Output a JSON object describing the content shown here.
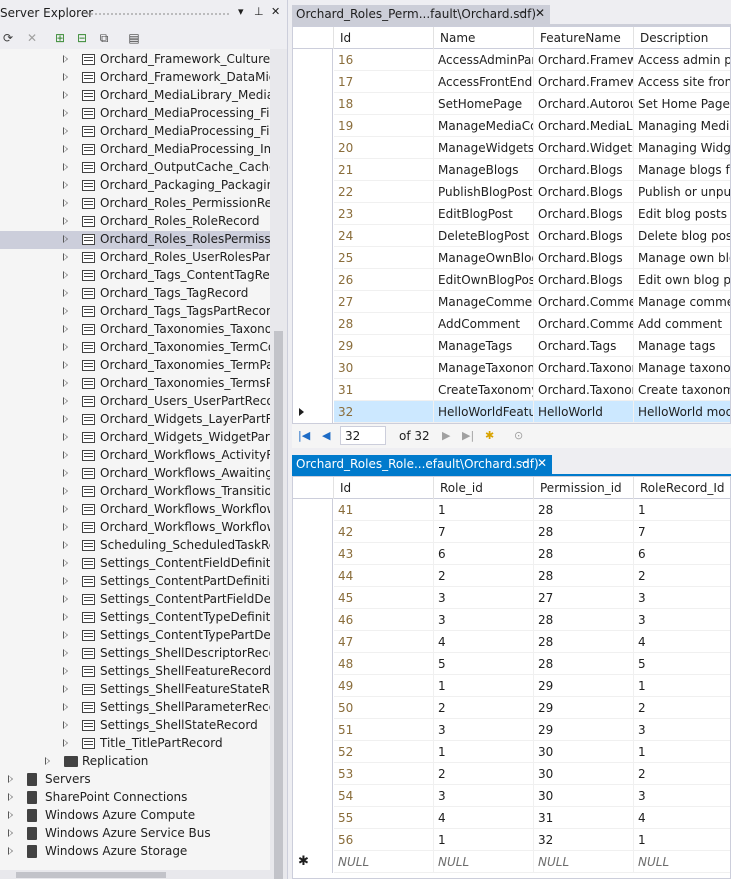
{
  "server_explorer": {
    "title": "Server Explorer",
    "tree": [
      {
        "label": "Orchard_Framework_CultureRecord",
        "type": "table",
        "level": 2
      },
      {
        "label": "Orchard_Framework_DataMigrationRecord",
        "type": "table",
        "level": 2
      },
      {
        "label": "Orchard_MediaLibrary_MediaPartRecord",
        "type": "table",
        "level": 2
      },
      {
        "label": "Orchard_MediaProcessing_FileNameRecord",
        "type": "table",
        "level": 2
      },
      {
        "label": "Orchard_MediaProcessing_FilterRecord",
        "type": "table",
        "level": 2
      },
      {
        "label": "Orchard_MediaProcessing_ImageProfilePartRecord",
        "type": "table",
        "level": 2
      },
      {
        "label": "Orchard_OutputCache_CacheParameterRecord",
        "type": "table",
        "level": 2
      },
      {
        "label": "Orchard_Packaging_PackagingSource",
        "type": "table",
        "level": 2
      },
      {
        "label": "Orchard_Roles_PermissionRecord",
        "type": "table",
        "level": 2
      },
      {
        "label": "Orchard_Roles_RoleRecord",
        "type": "table",
        "level": 2
      },
      {
        "label": "Orchard_Roles_RolesPermissionsRecord",
        "type": "table",
        "level": 2,
        "selected": true
      },
      {
        "label": "Orchard_Roles_UserRolesPartRecord",
        "type": "table",
        "level": 2
      },
      {
        "label": "Orchard_Tags_ContentTagRecord",
        "type": "table",
        "level": 2
      },
      {
        "label": "Orchard_Tags_TagRecord",
        "type": "table",
        "level": 2
      },
      {
        "label": "Orchard_Tags_TagsPartRecord",
        "type": "table",
        "level": 2
      },
      {
        "label": "Orchard_Taxonomies_TaxonomyPartRecord",
        "type": "table",
        "level": 2
      },
      {
        "label": "Orchard_Taxonomies_TermContentItem",
        "type": "table",
        "level": 2
      },
      {
        "label": "Orchard_Taxonomies_TermPartRecord",
        "type": "table",
        "level": 2
      },
      {
        "label": "Orchard_Taxonomies_TermsPartRecord",
        "type": "table",
        "level": 2
      },
      {
        "label": "Orchard_Users_UserPartRecord",
        "type": "table",
        "level": 2
      },
      {
        "label": "Orchard_Widgets_LayerPartRecord",
        "type": "table",
        "level": 2
      },
      {
        "label": "Orchard_Widgets_WidgetPartRecord",
        "type": "table",
        "level": 2
      },
      {
        "label": "Orchard_Workflows_ActivityRecord",
        "type": "table",
        "level": 2
      },
      {
        "label": "Orchard_Workflows_AwaitingActivityRecord",
        "type": "table",
        "level": 2
      },
      {
        "label": "Orchard_Workflows_TransitionRecord",
        "type": "table",
        "level": 2
      },
      {
        "label": "Orchard_Workflows_WorkflowDefinitionRecord",
        "type": "table",
        "level": 2
      },
      {
        "label": "Orchard_Workflows_WorkflowRecord",
        "type": "table",
        "level": 2
      },
      {
        "label": "Scheduling_ScheduledTaskRecord",
        "type": "table",
        "level": 2
      },
      {
        "label": "Settings_ContentFieldDefinitionRecord",
        "type": "table",
        "level": 2
      },
      {
        "label": "Settings_ContentPartDefinitionRecord",
        "type": "table",
        "level": 2
      },
      {
        "label": "Settings_ContentPartFieldDefinitionRecord",
        "type": "table",
        "level": 2
      },
      {
        "label": "Settings_ContentTypeDefinitionRecord",
        "type": "table",
        "level": 2
      },
      {
        "label": "Settings_ContentTypePartDefinitionRecord",
        "type": "table",
        "level": 2
      },
      {
        "label": "Settings_ShellDescriptorRecord",
        "type": "table",
        "level": 2
      },
      {
        "label": "Settings_ShellFeatureRecord",
        "type": "table",
        "level": 2
      },
      {
        "label": "Settings_ShellFeatureStateRecord",
        "type": "table",
        "level": 2
      },
      {
        "label": "Settings_ShellParameterRecord",
        "type": "table",
        "level": 2
      },
      {
        "label": "Settings_ShellStateRecord",
        "type": "table",
        "level": 2
      },
      {
        "label": "Title_TitlePartRecord",
        "type": "table",
        "level": 2
      },
      {
        "label": "Replication",
        "type": "folder",
        "level": 1
      },
      {
        "label": "Servers",
        "type": "server",
        "level": 0
      },
      {
        "label": "SharePoint Connections",
        "type": "server",
        "level": 0
      },
      {
        "label": "Windows Azure Compute",
        "type": "server",
        "level": 0
      },
      {
        "label": "Windows Azure Service Bus",
        "type": "server",
        "level": 0
      },
      {
        "label": "Windows Azure Storage",
        "type": "server",
        "level": 0
      }
    ]
  },
  "doc1": {
    "tab_label": "Orchard_Roles_Perm...fault\\Orchard.sdf)",
    "columns": [
      "Id",
      "Name",
      "FeatureName",
      "Description"
    ],
    "rows": [
      [
        "16",
        "AccessAdminPanel",
        "Orchard.Framework",
        "Access admin panel"
      ],
      [
        "17",
        "AccessFrontEnd",
        "Orchard.Framework",
        "Access site front-end"
      ],
      [
        "18",
        "SetHomePage",
        "Orchard.Autoroute",
        "Set Home Page"
      ],
      [
        "19",
        "ManageMediaContent",
        "Orchard.MediaLibrary",
        "Managing Media"
      ],
      [
        "20",
        "ManageWidgets",
        "Orchard.Widgets",
        "Managing Widgets"
      ],
      [
        "21",
        "ManageBlogs",
        "Orchard.Blogs",
        "Manage blogs for others"
      ],
      [
        "22",
        "PublishBlogPost",
        "Orchard.Blogs",
        "Publish or unpublish"
      ],
      [
        "23",
        "EditBlogPost",
        "Orchard.Blogs",
        "Edit blog posts"
      ],
      [
        "24",
        "DeleteBlogPost",
        "Orchard.Blogs",
        "Delete blog posts"
      ],
      [
        "25",
        "ManageOwnBlogs",
        "Orchard.Blogs",
        "Manage own blogs"
      ],
      [
        "26",
        "EditOwnBlogPost",
        "Orchard.Blogs",
        "Edit own blog posts"
      ],
      [
        "27",
        "ManageComments",
        "Orchard.Comments",
        "Manage comments"
      ],
      [
        "28",
        "AddComment",
        "Orchard.Comments",
        "Add comment"
      ],
      [
        "29",
        "ManageTags",
        "Orchard.Tags",
        "Manage tags"
      ],
      [
        "30",
        "ManageTaxonomies",
        "Orchard.Taxonomies",
        "Manage taxonomies"
      ],
      [
        "31",
        "CreateTaxonomy",
        "Orchard.Taxonomies",
        "Create taxonomy"
      ],
      [
        "32",
        "HelloWorldFeature",
        "HelloWorld",
        "HelloWorld module"
      ]
    ],
    "selected_row_index": 16,
    "navigator": {
      "position": "32",
      "of_text": "of 32"
    }
  },
  "doc2": {
    "tab_label": "Orchard_Roles_Role...efault\\Orchard.sdf)",
    "columns": [
      "Id",
      "Role_id",
      "Permission_id",
      "RoleRecord_Id"
    ],
    "rows": [
      [
        "41",
        "1",
        "28",
        "1"
      ],
      [
        "42",
        "7",
        "28",
        "7"
      ],
      [
        "43",
        "6",
        "28",
        "6"
      ],
      [
        "44",
        "2",
        "28",
        "2"
      ],
      [
        "45",
        "3",
        "27",
        "3"
      ],
      [
        "46",
        "3",
        "28",
        "3"
      ],
      [
        "47",
        "4",
        "28",
        "4"
      ],
      [
        "48",
        "5",
        "28",
        "5"
      ],
      [
        "49",
        "1",
        "29",
        "1"
      ],
      [
        "50",
        "2",
        "29",
        "2"
      ],
      [
        "51",
        "3",
        "29",
        "3"
      ],
      [
        "52",
        "1",
        "30",
        "1"
      ],
      [
        "53",
        "2",
        "30",
        "2"
      ],
      [
        "54",
        "3",
        "30",
        "3"
      ],
      [
        "55",
        "4",
        "31",
        "4"
      ],
      [
        "56",
        "1",
        "32",
        "1"
      ]
    ],
    "new_row": [
      "NULL",
      "NULL",
      "NULL",
      "NULL"
    ]
  },
  "colors": {
    "active_tab": "#007acc",
    "inactive_tab": "#ccced8",
    "selection": "#cce8ff",
    "id_text": "#8a6d3b"
  }
}
